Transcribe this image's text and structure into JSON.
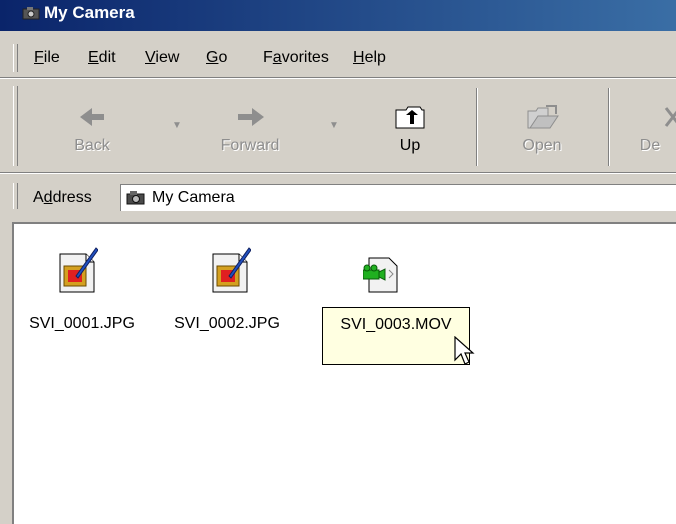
{
  "window": {
    "title": "My Camera",
    "icon": "camera-icon"
  },
  "menu": {
    "items": [
      {
        "pre": "",
        "u": "F",
        "post": "ile"
      },
      {
        "pre": "",
        "u": "E",
        "post": "dit"
      },
      {
        "pre": "",
        "u": "V",
        "post": "iew"
      },
      {
        "pre": "",
        "u": "G",
        "post": "o"
      },
      {
        "pre": "F",
        "u": "a",
        "post": "vorites"
      },
      {
        "pre": "",
        "u": "H",
        "post": "elp"
      }
    ]
  },
  "toolbar": {
    "back_label": "Back",
    "forward_label": "Forward",
    "up_label": "Up",
    "open_label": "Open",
    "delete_label": "De"
  },
  "address": {
    "label_pre": "A",
    "label_u": "d",
    "label_post": "dress",
    "value": "My Camera",
    "icon": "camera-icon"
  },
  "files": [
    {
      "name": "SVI_0001.JPG",
      "icon": "jpg-image-icon"
    },
    {
      "name": "SVI_0002.JPG",
      "icon": "jpg-image-icon"
    },
    {
      "name": "SVI_0003.MOV",
      "icon": "movie-file-icon",
      "selected": true
    }
  ],
  "colors": {
    "titlebar_start": "#0a246a",
    "titlebar_end": "#3a6ea5",
    "chrome": "#d4d0c8",
    "tooltip_bg": "#ffffe1"
  }
}
